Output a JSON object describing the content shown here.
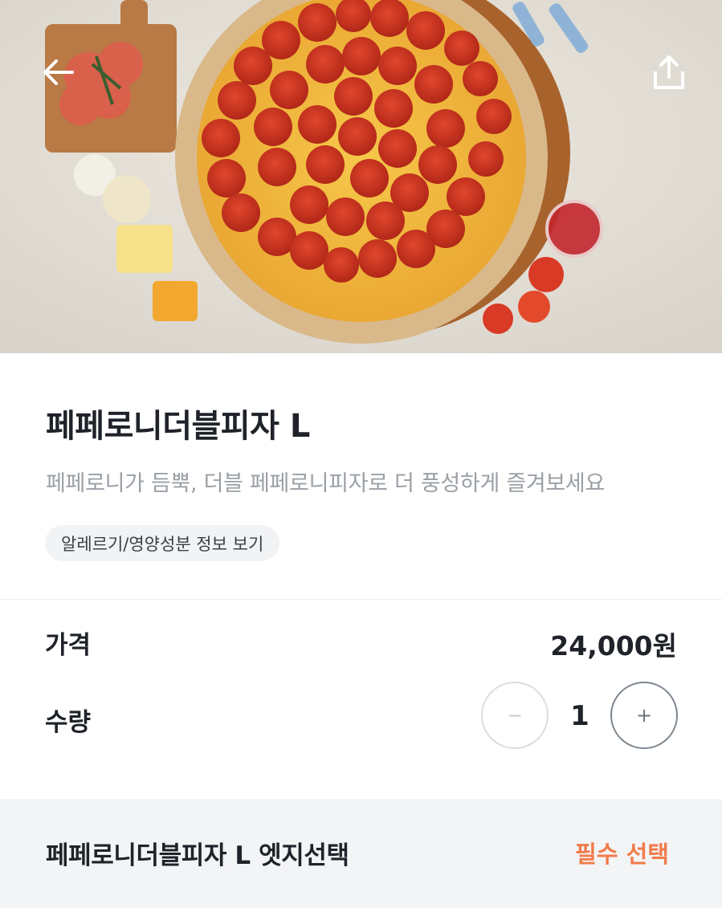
{
  "header": {
    "back_icon": "arrow-left-icon",
    "share_icon": "share-icon"
  },
  "product": {
    "name": "페페로니더블피자 L",
    "description": "페페로니가 듬뿍, 더블 페페로니피자로 더 풍성하게 즐겨보세요",
    "allergy_chip": "알레르기/영양성분 정보 보기"
  },
  "price": {
    "label": "가격",
    "value": "24,000원"
  },
  "quantity": {
    "label": "수량",
    "value": "1",
    "minus": "−",
    "plus": "+"
  },
  "option": {
    "title": "페페로니더블피자 L 엣지선택",
    "required": "필수 선택",
    "required_color": "#f07b4a"
  }
}
